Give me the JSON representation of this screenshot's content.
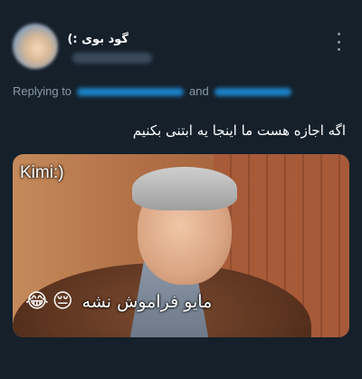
{
  "tweet": {
    "display_name": "گود بوی :)",
    "replying_prefix": "Replying to",
    "replying_and": "and",
    "text": "اگه اجازه هست ما اینجا یه ابتنی بکنیم",
    "media": {
      "caption_top": "Kimi:)",
      "caption_bottom": "مایو فراموش نشه",
      "emoji_1": "😂",
      "emoji_2": "😔"
    }
  },
  "colors": {
    "background": "#15202b",
    "secondary_text": "#8899a6",
    "link": "#1d9bf0"
  },
  "icons": {
    "more": "more-vertical-icon"
  }
}
